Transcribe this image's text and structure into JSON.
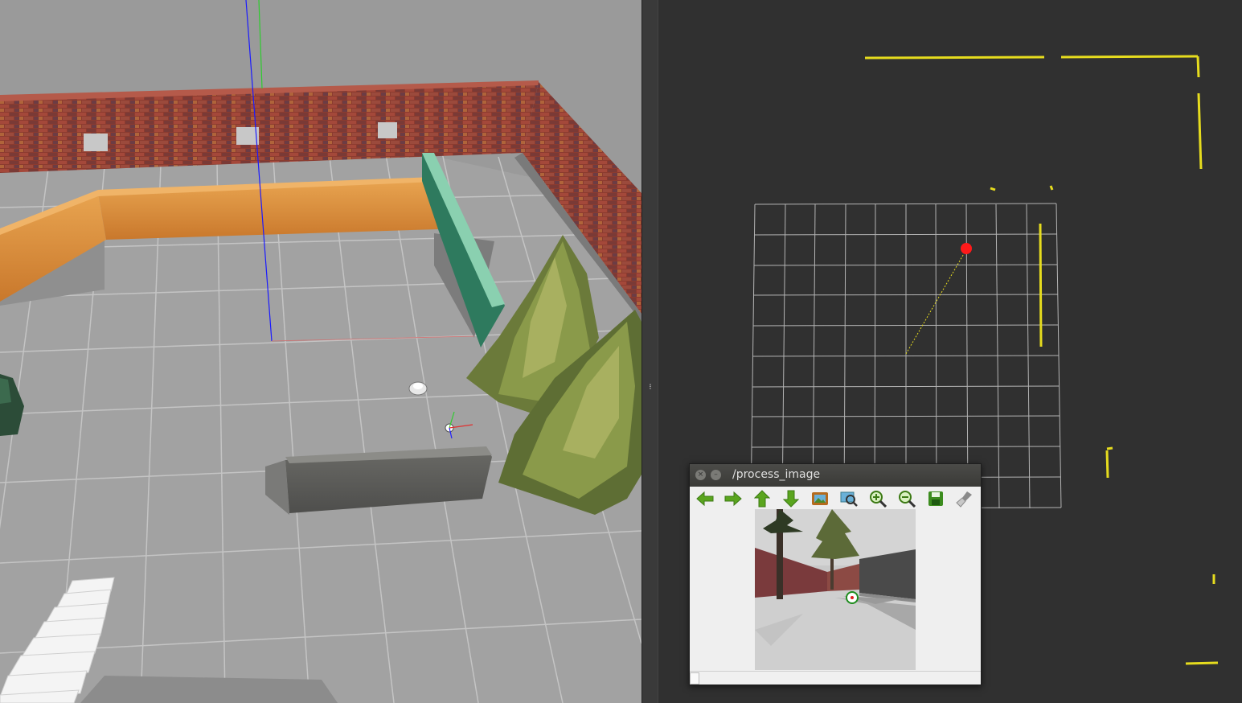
{
  "image_viewer": {
    "title": "/process_image",
    "toolbar": [
      {
        "name": "arrow-left-icon",
        "color": "#5aa51e"
      },
      {
        "name": "arrow-right-icon",
        "color": "#5aa51e"
      },
      {
        "name": "arrow-up-icon",
        "color": "#5aa51e"
      },
      {
        "name": "arrow-down-icon",
        "color": "#5aa51e"
      },
      {
        "name": "image-icon",
        "color": "#b46a1e"
      },
      {
        "name": "zoom-fit-icon",
        "color": "#3a7a8a"
      },
      {
        "name": "zoom-in-icon",
        "color": "#5aa51e"
      },
      {
        "name": "zoom-out-icon",
        "color": "#5aa51e"
      },
      {
        "name": "save-icon",
        "color": "#3c8c1e"
      },
      {
        "name": "clear-icon",
        "color": "#8a8a8a"
      }
    ]
  },
  "colors": {
    "laser_scan": "#e6dc1e",
    "goal_marker": "#ff1a1a",
    "grid": "#b4b4b4",
    "sim_background": "#9a9a9a",
    "viz_background": "#303030"
  },
  "splitter": {
    "handle_icon": "grip-icon"
  }
}
